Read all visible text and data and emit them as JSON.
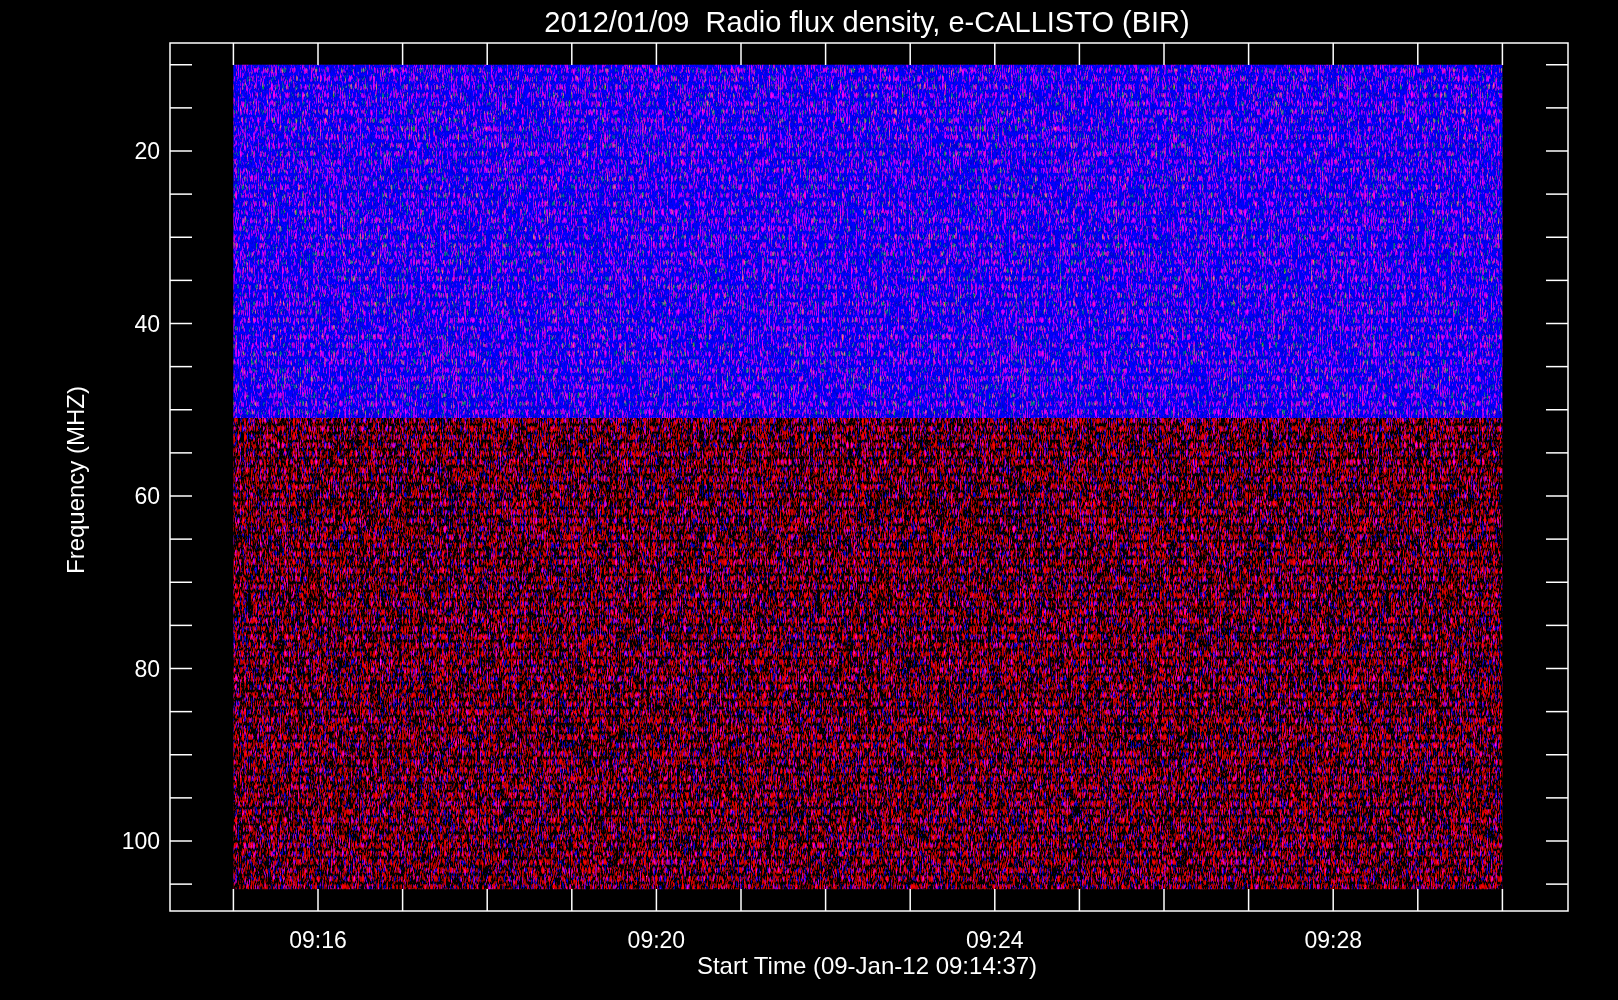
{
  "title": "2012/01/09  Radio flux density, e-CALLISTO (BIR)",
  "xlabel": "Start Time (09-Jan-12 09:14:37)",
  "ylabel": "Frequency (MHZ)",
  "yticks": [
    "20",
    "40",
    "60",
    "80",
    "100"
  ],
  "xticks": [
    "09:16",
    "09:20",
    "09:24",
    "09:28"
  ]
}
